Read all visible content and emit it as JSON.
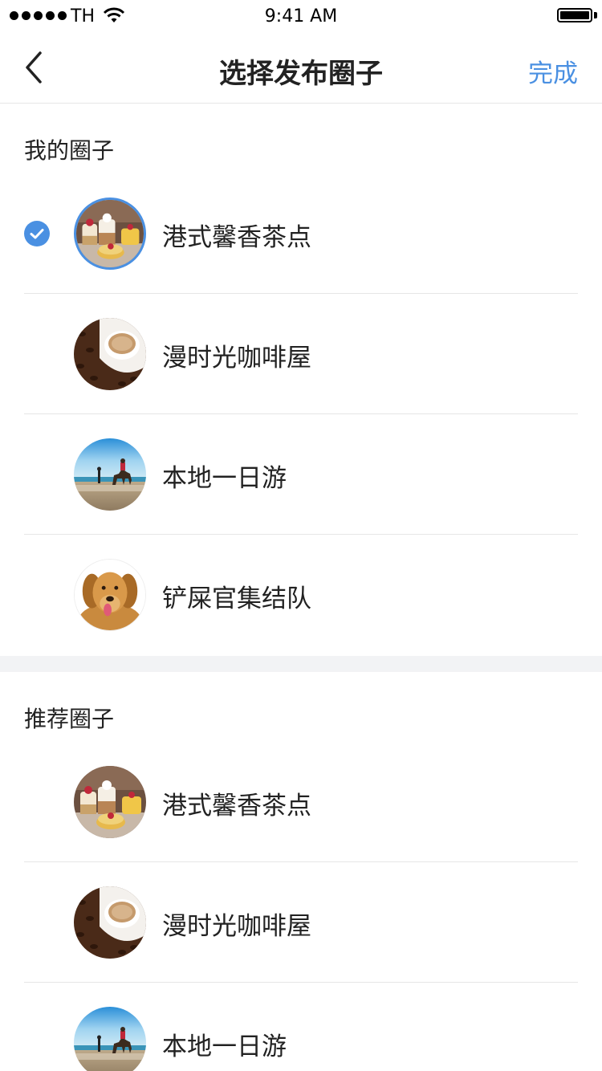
{
  "status": {
    "carrier": "TH",
    "time": "9:41 AM"
  },
  "nav": {
    "title": "选择发布圈子",
    "done_label": "完成"
  },
  "my_circles": {
    "header": "我的圈子",
    "items": [
      {
        "label": "港式馨香茶点",
        "image": "dessert",
        "selected": true
      },
      {
        "label": "漫时光咖啡屋",
        "image": "coffee",
        "selected": false
      },
      {
        "label": "本地一日游",
        "image": "beach",
        "selected": false
      },
      {
        "label": "铲屎官集结队",
        "image": "dog",
        "selected": false
      }
    ]
  },
  "recommended_circles": {
    "header": "推荐圈子",
    "items": [
      {
        "label": "港式馨香茶点",
        "image": "dessert"
      },
      {
        "label": "漫时光咖啡屋",
        "image": "coffee"
      },
      {
        "label": "本地一日游",
        "image": "beach"
      }
    ]
  },
  "colors": {
    "accent": "#4a90e2",
    "divider": "#e6e6e6",
    "section_gap": "#f2f3f5"
  }
}
